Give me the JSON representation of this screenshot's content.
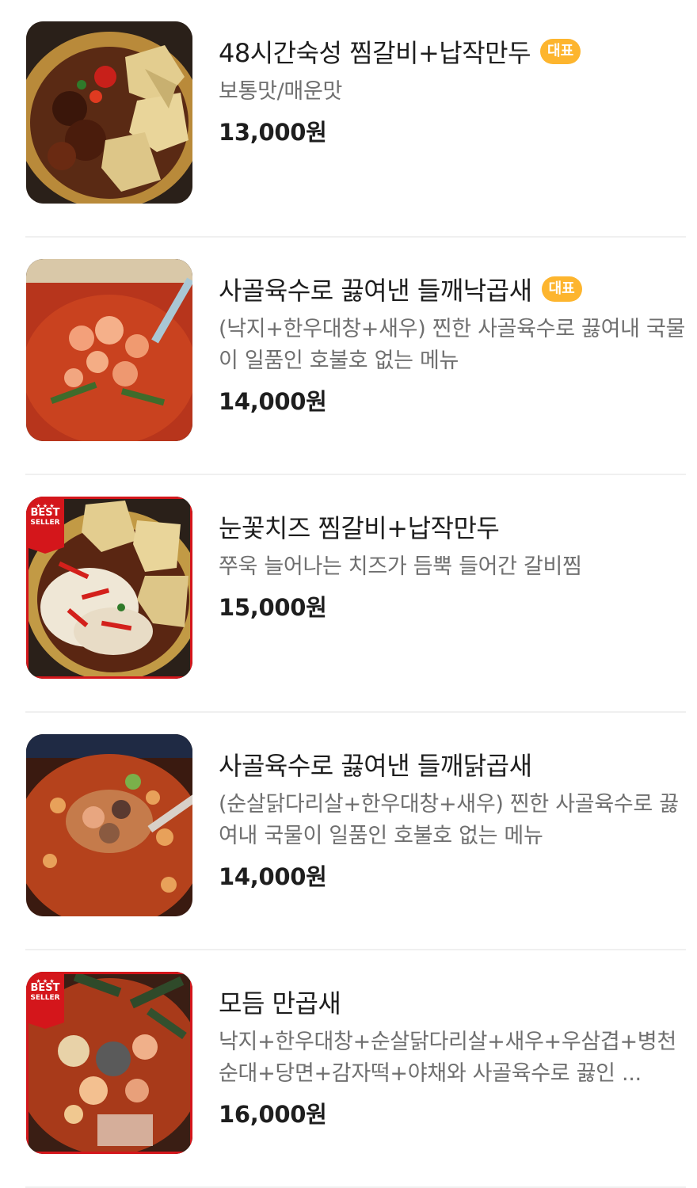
{
  "menu": {
    "items": [
      {
        "name": "48시간숙성 찜갈비+납작만두",
        "badge": "대표",
        "description": "보통맛/매운맛",
        "price": "13,000원",
        "image_icon": "braised-short-rib-with-flat-dumplings-photo",
        "best_seller": ""
      },
      {
        "name": "사골육수로 끓여낸 들깨낙곱새",
        "badge": "대표",
        "description": "(낙지+한우대창+새우) 찐한 사골육수로 끓여내 국물이 일품인 호불호 없는 메뉴",
        "price": "14,000원",
        "image_icon": "octopus-tripe-shrimp-stew-photo",
        "best_seller": ""
      },
      {
        "name": "눈꽃치즈 찜갈비+납작만두",
        "badge": "",
        "description": "쭈욱 늘어나는 치즈가 듬뿍 들어간 갈비찜",
        "price": "15,000원",
        "image_icon": "cheese-braised-short-rib-photo",
        "best_seller": {
          "line1": "BEST",
          "line2": "SELLER"
        }
      },
      {
        "name": "사골육수로 끓여낸 들깨닭곱새",
        "badge": "",
        "description": "(순살닭다리살+한우대창+새우) 찐한 사골육수로 끓여내 국물이 일품인 호불호 없는 메뉴",
        "price": "14,000원",
        "image_icon": "chicken-tripe-shrimp-stew-photo",
        "best_seller": ""
      },
      {
        "name": "모듬 만곱새",
        "badge": "",
        "description": "낙지+한우대창+순살닭다리살+새우+우삼겹+병천순대+당면+감자떡+야채와 사골육수로 끓인 ...",
        "price": "16,000원",
        "image_icon": "assorted-stew-photo",
        "best_seller": {
          "line1": "BEST",
          "line2": "SELLER"
        }
      }
    ]
  },
  "colors": {
    "badge_bg": "#fdb52e",
    "best_seller_red": "#d4161b",
    "divider": "#f0f0f0"
  }
}
